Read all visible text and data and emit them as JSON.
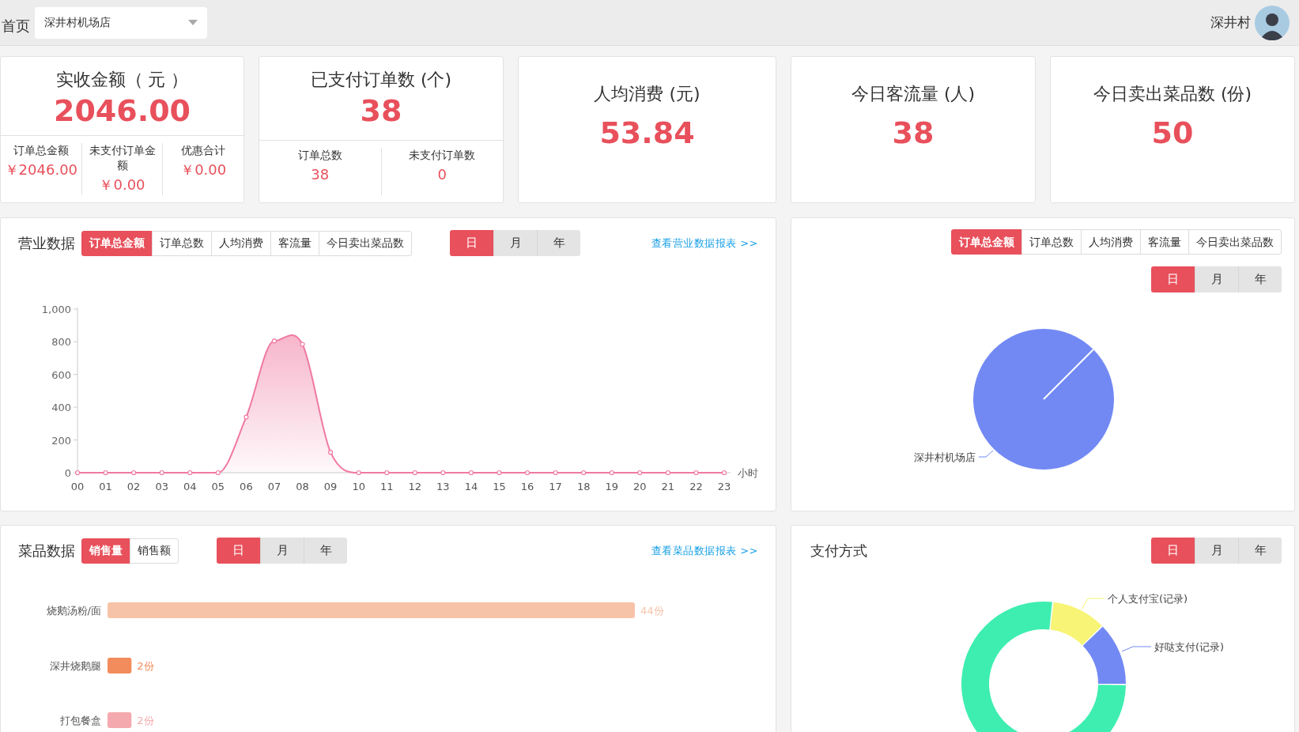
{
  "header": {
    "breadcrumb": "首页",
    "store_select": {
      "value": "深井村机场店"
    },
    "user": {
      "name": "深井村"
    }
  },
  "stat_cards": [
    {
      "title": "实收金额（ 元 ）",
      "value": "2046.00",
      "details": [
        {
          "label": "订单总金额",
          "value": "￥2046.00"
        },
        {
          "label": "未支付订单金额",
          "value": "￥0.00"
        },
        {
          "label": "优惠合计",
          "value": "￥0.00"
        }
      ]
    },
    {
      "title": "已支付订单数 (个)",
      "value": "38",
      "details": [
        {
          "label": "订单总数",
          "value": "38"
        },
        {
          "label": "未支付订单数",
          "value": "0"
        }
      ]
    },
    {
      "title": "人均消费 (元)",
      "value": "53.84"
    },
    {
      "title": "今日客流量 (人)",
      "value": "38"
    },
    {
      "title": "今日卖出菜品数 (份)",
      "value": "50"
    }
  ],
  "sales_panel": {
    "title": "营业数据",
    "metric_tabs": [
      {
        "label": "订单总金额",
        "selected": true
      },
      {
        "label": "订单总数",
        "selected": false
      },
      {
        "label": "人均消费",
        "selected": false
      },
      {
        "label": "客流量",
        "selected": false
      },
      {
        "label": "今日卖出菜品数",
        "selected": false
      }
    ],
    "period_tabs": [
      {
        "label": "日",
        "selected": true
      },
      {
        "label": "月",
        "selected": false
      },
      {
        "label": "年",
        "selected": false
      }
    ],
    "report_link": "查看营业数据报表 >>",
    "chart_data": {
      "type": "area",
      "xlabel": "小时",
      "categories": [
        "00",
        "01",
        "02",
        "03",
        "04",
        "05",
        "06",
        "07",
        "08",
        "09",
        "10",
        "11",
        "12",
        "13",
        "14",
        "15",
        "16",
        "17",
        "18",
        "19",
        "20",
        "21",
        "22",
        "23"
      ],
      "color": "#f07aa0",
      "values": [
        0,
        0,
        0,
        0,
        0,
        0,
        340,
        805,
        785,
        125,
        0,
        0,
        0,
        0,
        0,
        0,
        0,
        0,
        0,
        0,
        0,
        0,
        0,
        0
      ],
      "ylim": [
        0,
        1000
      ],
      "yticks": [
        0,
        200,
        400,
        600,
        800,
        {
          "value": 1000,
          "label": "1,000"
        }
      ]
    }
  },
  "store_panel": {
    "metric_tabs": [
      {
        "label": "订单总金额",
        "selected": true
      },
      {
        "label": "订单总数",
        "selected": false
      },
      {
        "label": "人均消费",
        "selected": false
      },
      {
        "label": "客流量",
        "selected": false
      },
      {
        "label": "今日卖出菜品数",
        "selected": false
      }
    ],
    "period_tabs": [
      {
        "label": "日",
        "selected": true
      },
      {
        "label": "月",
        "selected": false
      },
      {
        "label": "年",
        "selected": false
      }
    ],
    "pie": {
      "label": "深井村机场店",
      "color": "#7289f4"
    }
  },
  "dish_panel": {
    "title": "菜品数据",
    "metric_tabs": [
      {
        "label": "销售量",
        "selected": true
      },
      {
        "label": "销售额",
        "selected": false
      }
    ],
    "period_tabs": [
      {
        "label": "日",
        "selected": true
      },
      {
        "label": "月",
        "selected": false
      },
      {
        "label": "年",
        "selected": false
      }
    ],
    "report_link": "查看菜品数据报表 >>",
    "chart_data": {
      "type": "bar",
      "orientation": "horizontal",
      "categories": [
        "烧鹅汤粉/面",
        "深井烧鹅腿",
        "打包餐盒"
      ],
      "values": [
        44,
        2,
        2
      ],
      "colors": [
        "#f7c3a8",
        "#f28c5c",
        "#f4a9ae"
      ],
      "value_labels": [
        "44份",
        "2份",
        "2份"
      ]
    }
  },
  "payment_panel": {
    "title": "支付方式",
    "period_tabs": [
      {
        "label": "日",
        "selected": true
      },
      {
        "label": "月",
        "selected": false
      },
      {
        "label": "年",
        "selected": false
      }
    ],
    "slices": [
      {
        "label": "个人支付宝(记录)",
        "color": "#f8f475"
      },
      {
        "label": "好哒支付(记录)",
        "color": "#7289f4"
      }
    ]
  }
}
